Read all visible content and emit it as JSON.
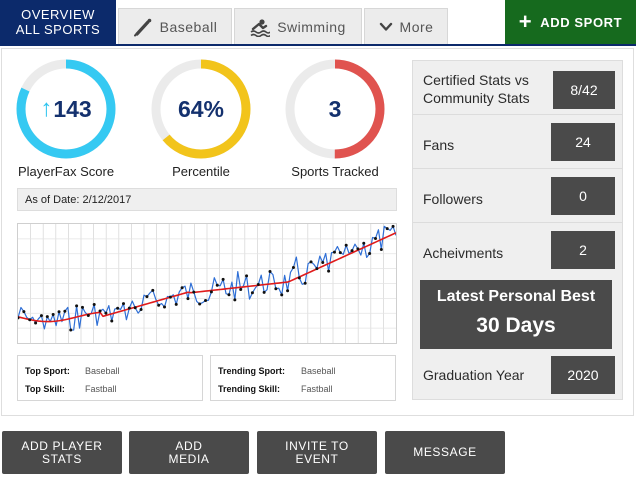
{
  "nav": {
    "overview_line1": "OVERVIEW",
    "overview_line2": "ALL SPORTS",
    "tabs": [
      {
        "label": "Baseball",
        "icon": "baseball-bat-icon"
      },
      {
        "label": "Swimming",
        "icon": "swimmer-icon"
      },
      {
        "label": "More",
        "icon": "chevron-down-icon"
      }
    ],
    "add_sport": "ADD SPORT"
  },
  "gauges": [
    {
      "value": "143",
      "label": "PlayerFax Score",
      "fill": 0.82,
      "color": "#35c9f2",
      "icon": "arrow-up-icon"
    },
    {
      "value": "64%",
      "label": "Percentile",
      "fill": 0.64,
      "color": "#f2c41b"
    },
    {
      "value": "3",
      "label": "Sports Tracked",
      "fill": 0.5,
      "color": "#e0534f"
    }
  ],
  "as_of": "As of Date: 2/12/2017",
  "summary": {
    "top_sport_label": "Top Sport:",
    "top_sport": "Baseball",
    "top_skill_label": "Top Skill:",
    "top_skill": "Fastball",
    "trending_sport_label": "Trending Sport:",
    "trending_sport": "Baseball",
    "trending_skill_label": "Trending Skill:",
    "trending_skill": "Fastball"
  },
  "stats": {
    "certified_line1": "Certified Stats vs",
    "certified_line2": "Community Stats",
    "certified_value": "8/42",
    "fans_label": "Fans",
    "fans_value": "24",
    "followers_label": "Followers",
    "followers_value": "0",
    "achievements_label": "Acheivments",
    "achievements_value": "2",
    "best_title": "Latest Personal Best",
    "best_value": "30 Days",
    "graduation_label": "Graduation Year",
    "graduation_value": "2020"
  },
  "buttons": [
    {
      "line1": "ADD PLAYER",
      "line2": "STATS"
    },
    {
      "line1": "ADD",
      "line2": "MEDIA"
    },
    {
      "line1": "INVITE TO",
      "line2": "EVENT"
    },
    {
      "line1": "MESSAGE",
      "line2": ""
    }
  ],
  "colors": {
    "navy": "#0c2a6b",
    "green": "#166a1e",
    "dark_gray": "#4a4a4a",
    "raw_line": "#2f6fd6",
    "trend_line": "#e01b1b"
  }
}
